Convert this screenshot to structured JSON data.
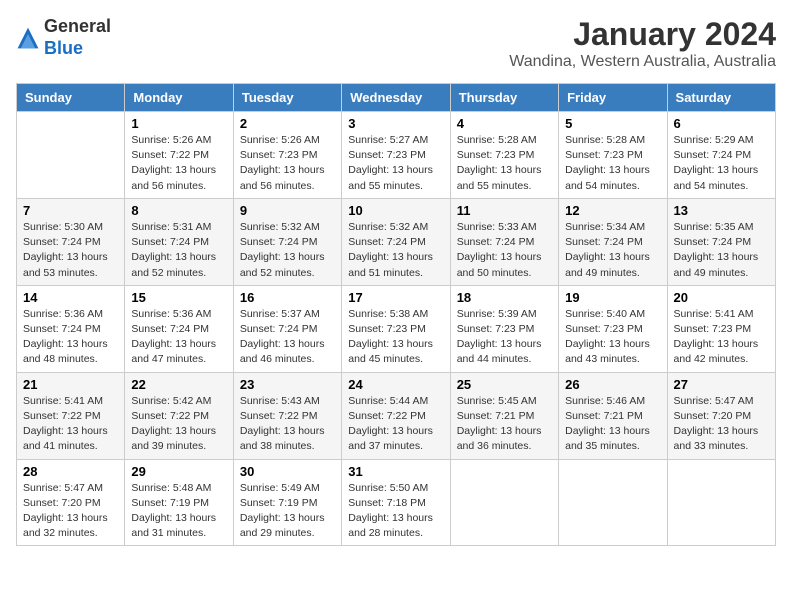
{
  "logo": {
    "general": "General",
    "blue": "Blue"
  },
  "title": "January 2024",
  "subtitle": "Wandina, Western Australia, Australia",
  "headers": [
    "Sunday",
    "Monday",
    "Tuesday",
    "Wednesday",
    "Thursday",
    "Friday",
    "Saturday"
  ],
  "weeks": [
    [
      {
        "day": "",
        "info": ""
      },
      {
        "day": "1",
        "info": "Sunrise: 5:26 AM\nSunset: 7:22 PM\nDaylight: 13 hours\nand 56 minutes."
      },
      {
        "day": "2",
        "info": "Sunrise: 5:26 AM\nSunset: 7:23 PM\nDaylight: 13 hours\nand 56 minutes."
      },
      {
        "day": "3",
        "info": "Sunrise: 5:27 AM\nSunset: 7:23 PM\nDaylight: 13 hours\nand 55 minutes."
      },
      {
        "day": "4",
        "info": "Sunrise: 5:28 AM\nSunset: 7:23 PM\nDaylight: 13 hours\nand 55 minutes."
      },
      {
        "day": "5",
        "info": "Sunrise: 5:28 AM\nSunset: 7:23 PM\nDaylight: 13 hours\nand 54 minutes."
      },
      {
        "day": "6",
        "info": "Sunrise: 5:29 AM\nSunset: 7:24 PM\nDaylight: 13 hours\nand 54 minutes."
      }
    ],
    [
      {
        "day": "7",
        "info": "Sunrise: 5:30 AM\nSunset: 7:24 PM\nDaylight: 13 hours\nand 53 minutes."
      },
      {
        "day": "8",
        "info": "Sunrise: 5:31 AM\nSunset: 7:24 PM\nDaylight: 13 hours\nand 52 minutes."
      },
      {
        "day": "9",
        "info": "Sunrise: 5:32 AM\nSunset: 7:24 PM\nDaylight: 13 hours\nand 52 minutes."
      },
      {
        "day": "10",
        "info": "Sunrise: 5:32 AM\nSunset: 7:24 PM\nDaylight: 13 hours\nand 51 minutes."
      },
      {
        "day": "11",
        "info": "Sunrise: 5:33 AM\nSunset: 7:24 PM\nDaylight: 13 hours\nand 50 minutes."
      },
      {
        "day": "12",
        "info": "Sunrise: 5:34 AM\nSunset: 7:24 PM\nDaylight: 13 hours\nand 49 minutes."
      },
      {
        "day": "13",
        "info": "Sunrise: 5:35 AM\nSunset: 7:24 PM\nDaylight: 13 hours\nand 49 minutes."
      }
    ],
    [
      {
        "day": "14",
        "info": "Sunrise: 5:36 AM\nSunset: 7:24 PM\nDaylight: 13 hours\nand 48 minutes."
      },
      {
        "day": "15",
        "info": "Sunrise: 5:36 AM\nSunset: 7:24 PM\nDaylight: 13 hours\nand 47 minutes."
      },
      {
        "day": "16",
        "info": "Sunrise: 5:37 AM\nSunset: 7:24 PM\nDaylight: 13 hours\nand 46 minutes."
      },
      {
        "day": "17",
        "info": "Sunrise: 5:38 AM\nSunset: 7:23 PM\nDaylight: 13 hours\nand 45 minutes."
      },
      {
        "day": "18",
        "info": "Sunrise: 5:39 AM\nSunset: 7:23 PM\nDaylight: 13 hours\nand 44 minutes."
      },
      {
        "day": "19",
        "info": "Sunrise: 5:40 AM\nSunset: 7:23 PM\nDaylight: 13 hours\nand 43 minutes."
      },
      {
        "day": "20",
        "info": "Sunrise: 5:41 AM\nSunset: 7:23 PM\nDaylight: 13 hours\nand 42 minutes."
      }
    ],
    [
      {
        "day": "21",
        "info": "Sunrise: 5:41 AM\nSunset: 7:22 PM\nDaylight: 13 hours\nand 41 minutes."
      },
      {
        "day": "22",
        "info": "Sunrise: 5:42 AM\nSunset: 7:22 PM\nDaylight: 13 hours\nand 39 minutes."
      },
      {
        "day": "23",
        "info": "Sunrise: 5:43 AM\nSunset: 7:22 PM\nDaylight: 13 hours\nand 38 minutes."
      },
      {
        "day": "24",
        "info": "Sunrise: 5:44 AM\nSunset: 7:22 PM\nDaylight: 13 hours\nand 37 minutes."
      },
      {
        "day": "25",
        "info": "Sunrise: 5:45 AM\nSunset: 7:21 PM\nDaylight: 13 hours\nand 36 minutes."
      },
      {
        "day": "26",
        "info": "Sunrise: 5:46 AM\nSunset: 7:21 PM\nDaylight: 13 hours\nand 35 minutes."
      },
      {
        "day": "27",
        "info": "Sunrise: 5:47 AM\nSunset: 7:20 PM\nDaylight: 13 hours\nand 33 minutes."
      }
    ],
    [
      {
        "day": "28",
        "info": "Sunrise: 5:47 AM\nSunset: 7:20 PM\nDaylight: 13 hours\nand 32 minutes."
      },
      {
        "day": "29",
        "info": "Sunrise: 5:48 AM\nSunset: 7:19 PM\nDaylight: 13 hours\nand 31 minutes."
      },
      {
        "day": "30",
        "info": "Sunrise: 5:49 AM\nSunset: 7:19 PM\nDaylight: 13 hours\nand 29 minutes."
      },
      {
        "day": "31",
        "info": "Sunrise: 5:50 AM\nSunset: 7:18 PM\nDaylight: 13 hours\nand 28 minutes."
      },
      {
        "day": "",
        "info": ""
      },
      {
        "day": "",
        "info": ""
      },
      {
        "day": "",
        "info": ""
      }
    ]
  ]
}
